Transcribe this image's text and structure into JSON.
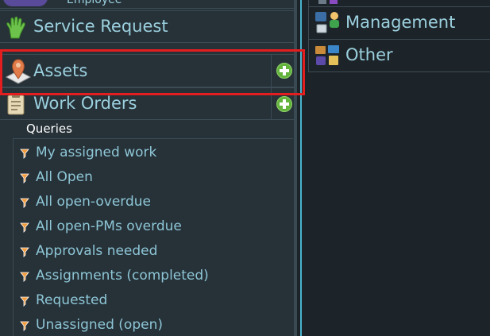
{
  "left_panel": {
    "top_partial_label": "Employee",
    "nav": [
      {
        "label": "Service Request",
        "icon": "hand-icon"
      },
      {
        "label": "Assets",
        "icon": "map-pin-icon"
      },
      {
        "label": "Work Orders",
        "icon": "clipboard-icon"
      }
    ],
    "queries_heading": "Queries",
    "queries": [
      "My assigned work",
      "All Open",
      "All open-overdue",
      "All open-PMs overdue",
      "Approvals needed",
      "Assignments (completed)",
      "Requested",
      "Unassigned (open)"
    ]
  },
  "right_panel": {
    "items": [
      {
        "label": "Management",
        "icon": "management-icon"
      },
      {
        "label": "Other",
        "icon": "other-icon"
      }
    ]
  },
  "colors": {
    "highlight": "#e41e1e",
    "add_button": "#63b33c",
    "link_text": "#8ec6d6",
    "panel_bg": "#263138"
  }
}
